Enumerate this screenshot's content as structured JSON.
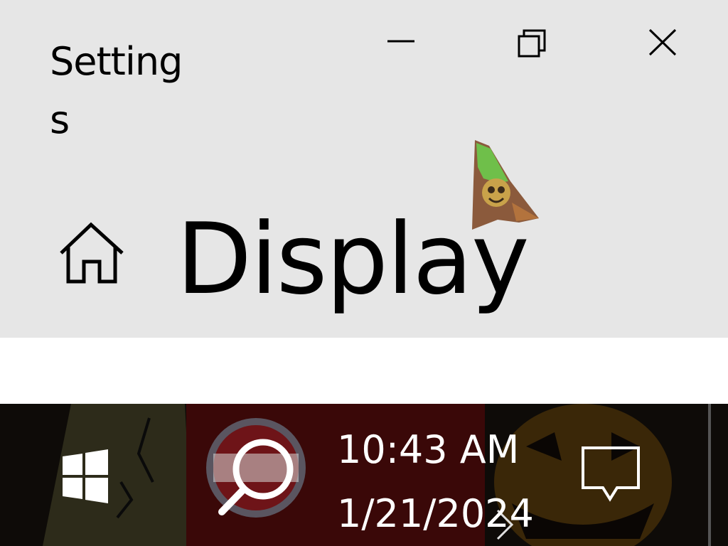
{
  "window": {
    "app_title": "Settings",
    "page_title": "Display",
    "controls": {
      "minimize_icon": "minimize-icon",
      "maximize_icon": "restore-icon",
      "close_icon": "close-icon"
    },
    "home_icon": "home-icon",
    "background_color": "#e6e6e6"
  },
  "taskbar": {
    "start_icon": "windows-logo-icon",
    "search_icon": "search-icon",
    "clock": {
      "time": "10:43 AM",
      "date": "1/21/2024"
    },
    "notification_icon": "action-center-icon",
    "background_color": "#120606",
    "text_color": "#ffffff"
  }
}
